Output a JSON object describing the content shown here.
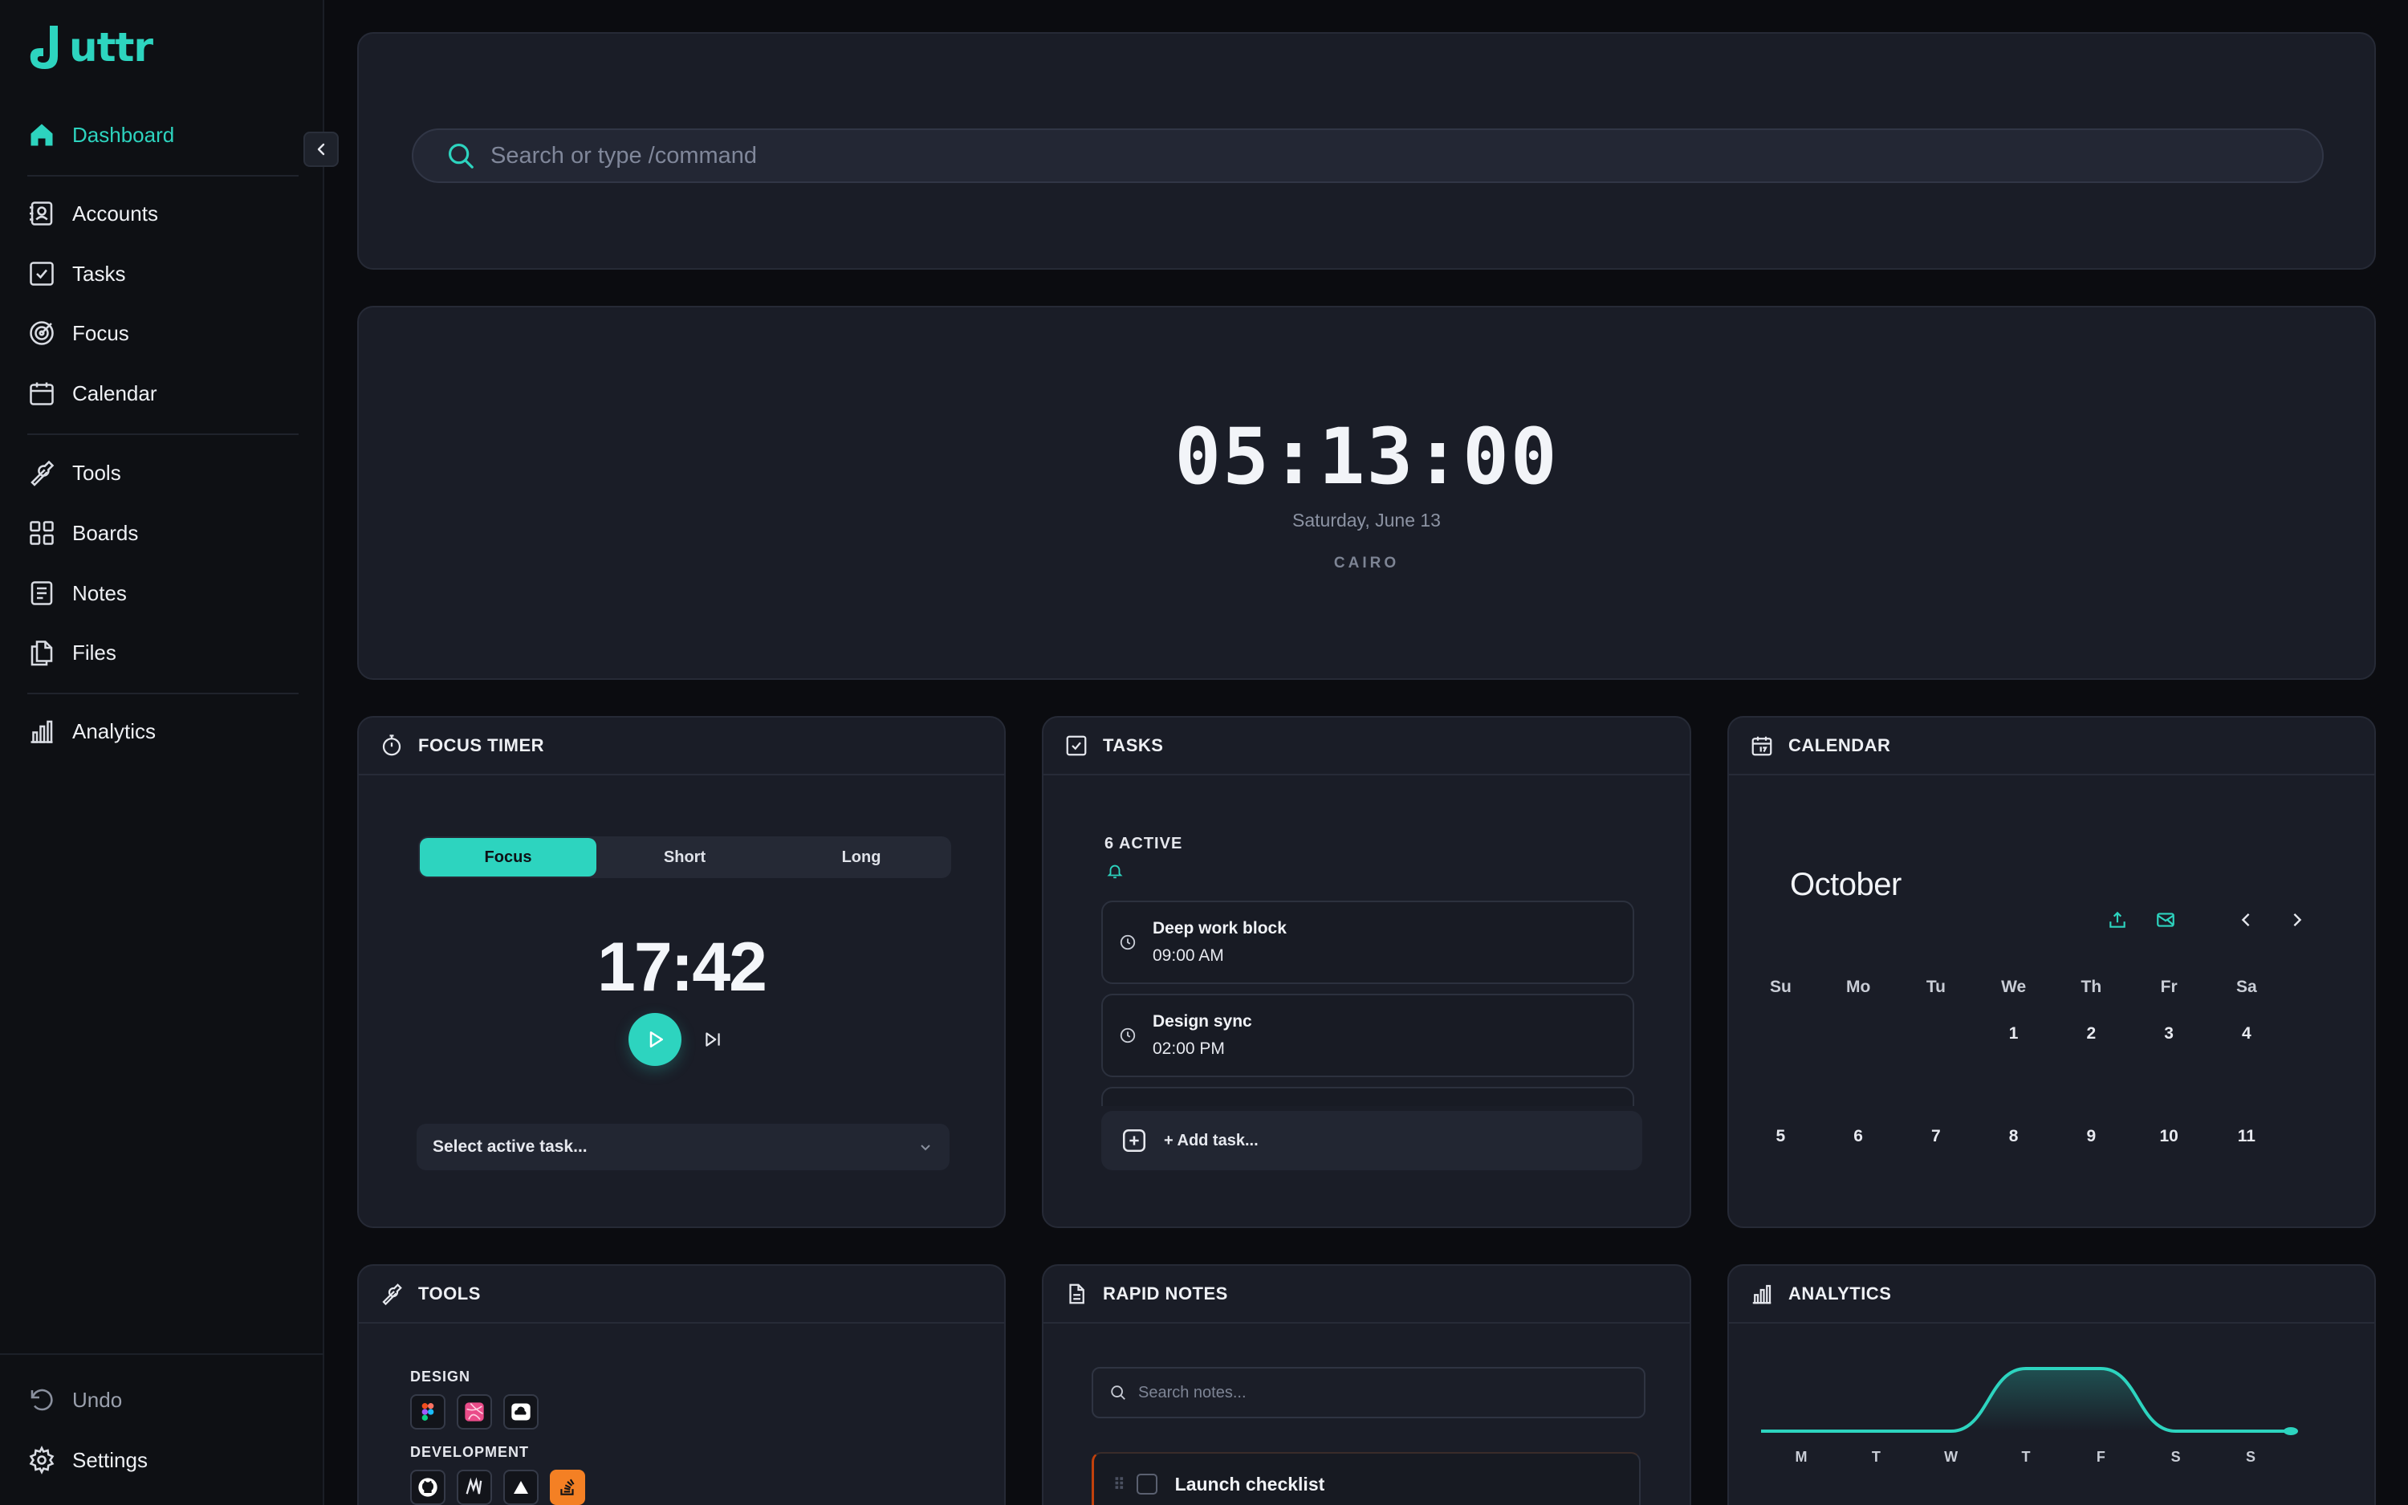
{
  "app": {
    "name": "uttr",
    "brand_color": "#2dd4bf"
  },
  "sidebar": {
    "items": [
      {
        "label": "Dashboard",
        "icon": "home-icon",
        "active": true
      },
      {
        "label": "Accounts",
        "icon": "contact-icon"
      },
      {
        "label": "Tasks",
        "icon": "checkbox-icon"
      },
      {
        "label": "Focus",
        "icon": "target-icon"
      },
      {
        "label": "Calendar",
        "icon": "calendar-icon"
      },
      {
        "label": "Tools",
        "icon": "wrench-icon"
      },
      {
        "label": "Boards",
        "icon": "grid-icon"
      },
      {
        "label": "Notes",
        "icon": "note-icon"
      },
      {
        "label": "Files",
        "icon": "files-icon"
      },
      {
        "label": "Analytics",
        "icon": "bar-chart-icon"
      }
    ],
    "footer": [
      {
        "label": "Undo",
        "icon": "undo-icon"
      },
      {
        "label": "Settings",
        "icon": "gear-icon"
      }
    ]
  },
  "search": {
    "placeholder": "Search or type /command"
  },
  "clock": {
    "time": "05:13:00",
    "date": "Saturday, June 13",
    "city": "CAIRO"
  },
  "focus_timer": {
    "title": "FOCUS TIMER",
    "modes": [
      "Focus",
      "Short",
      "Long"
    ],
    "active_mode": "Focus",
    "time": "17:42",
    "task_select": "Select active task..."
  },
  "tasks": {
    "title": "TASKS",
    "active_count": "6 ACTIVE",
    "items": [
      {
        "title": "Deep work block",
        "time": "09:00 AM"
      },
      {
        "title": "Design sync",
        "time": "02:00 PM"
      },
      {
        "title": "",
        "time": ""
      }
    ],
    "add_label": "+ Add task..."
  },
  "calendar": {
    "title": "CALENDAR",
    "month": "October",
    "weekdays": [
      "Su",
      "Mo",
      "Tu",
      "We",
      "Th",
      "Fr",
      "Sa"
    ],
    "weeks": [
      [
        "",
        "",
        "",
        "1",
        "2",
        "3",
        "4"
      ],
      [
        "5",
        "6",
        "7",
        "8",
        "9",
        "10",
        "11"
      ]
    ]
  },
  "tools": {
    "title": "TOOLS",
    "groups": [
      {
        "label": "DESIGN",
        "icons": [
          "figma-icon",
          "dribbble-icon",
          "cloud-icon"
        ]
      },
      {
        "label": "DEVELOPMENT",
        "icons": [
          "github-icon",
          "m-icon",
          "vercel-icon",
          "stackoverflow-icon"
        ]
      }
    ]
  },
  "notes": {
    "title": "RAPID NOTES",
    "search_placeholder": "Search notes...",
    "items": [
      {
        "title": "Launch checklist"
      }
    ]
  },
  "analytics": {
    "title": "ANALYTICS"
  },
  "chart_data": {
    "type": "area",
    "categories": [
      "M",
      "T",
      "W",
      "T",
      "F",
      "S",
      "S"
    ],
    "values": [
      0,
      0,
      0,
      1,
      1,
      0,
      0
    ],
    "color": "#2dd4bf"
  }
}
